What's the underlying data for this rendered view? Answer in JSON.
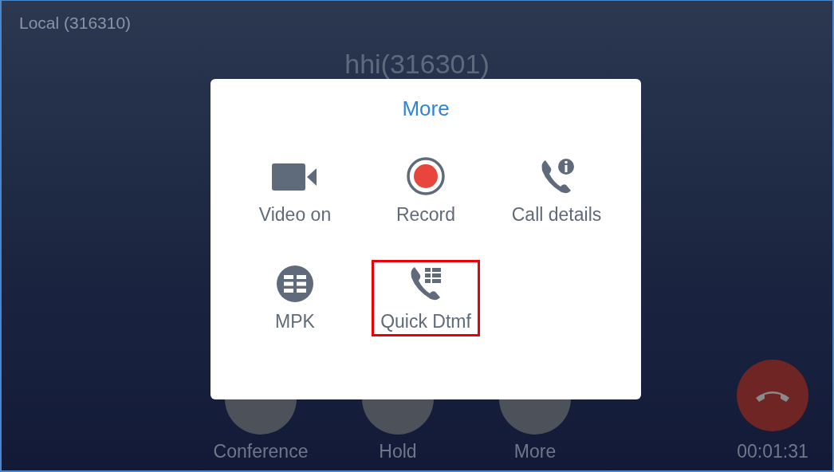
{
  "local_account": "Local (316310)",
  "caller": "hhi(316301)",
  "dialog": {
    "title": "More",
    "items": [
      {
        "kind": "video",
        "label": "Video on",
        "highlighted": false
      },
      {
        "kind": "record",
        "label": "Record",
        "highlighted": false
      },
      {
        "kind": "details",
        "label": "Call details",
        "highlighted": false
      },
      {
        "kind": "mpk",
        "label": "MPK",
        "highlighted": false
      },
      {
        "kind": "dtmf",
        "label": "Quick Dtmf",
        "highlighted": true
      }
    ]
  },
  "call_buttons": [
    {
      "label": "Conference"
    },
    {
      "label": "Hold"
    },
    {
      "label": "More"
    }
  ],
  "timer": "00:01:31"
}
